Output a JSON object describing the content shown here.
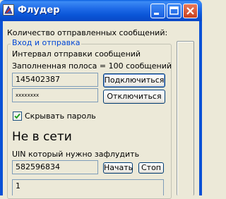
{
  "window": {
    "title": "Флудер",
    "controls": {
      "minimize": "minimize",
      "maximize": "maximize",
      "close": "close"
    }
  },
  "labels": {
    "sent_count": "Количество отправленных сообщений:",
    "group_title": "Вход и отправка",
    "send_interval": "Интервал отправки сообщений",
    "progress_note": "Заполненная полоса = 100 сообщений",
    "hide_password": "Скрывать пароль",
    "status": "Не в сети",
    "target_uin": "UIN который нужно зафлудить"
  },
  "fields": {
    "login_uin": "145402387",
    "password": "xxxxxxxx",
    "target_uin": "582596834",
    "message": "1"
  },
  "buttons": {
    "connect": "Подключиться",
    "disconnect": "Отключиться",
    "start": "Начать",
    "stop": "Стоп"
  },
  "checkbox": {
    "hide_password_checked": true
  },
  "colors": {
    "titlebar": "#0a5fe0",
    "group_title": "#0046d5",
    "close_button": "#c8411f"
  }
}
